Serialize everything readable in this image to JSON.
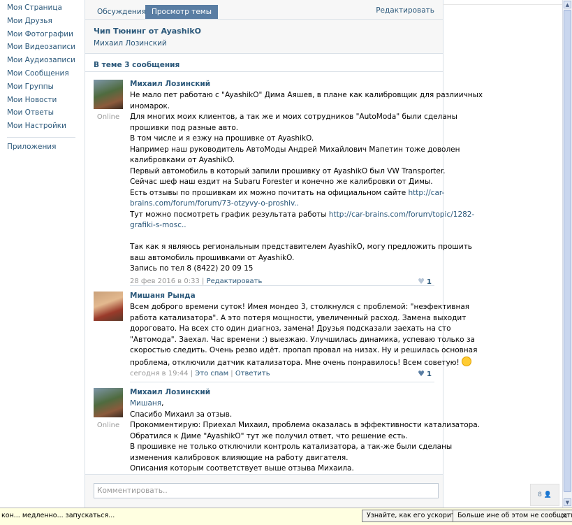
{
  "left_menu": {
    "items": [
      "Моя Страница",
      "Мои Друзья",
      "Мои Фотографии",
      "Мои Видеозаписи",
      "Мои Аудиозаписи",
      "Мои Сообщения",
      "Мои Группы",
      "Мои Новости",
      "Мои Ответы",
      "Мои Настройки"
    ],
    "apps": "Приложения"
  },
  "tabs": {
    "discussions": "Обсуждения",
    "view_topic": "Просмотр темы",
    "edit": "Редактировать"
  },
  "topic": {
    "title": "Чип Тюнинг от AyashikO",
    "author": "Михаил Лозинский",
    "count_text": "В теме 3 сообщения"
  },
  "posts": [
    {
      "author": "Михаил Лозинский",
      "status": "Online",
      "lines": [
        "Не мало пет работаю с \"AyashikO\" Дима Аяшев, в плане как калибровщик для разлиичных",
        "иномарок.",
        "Для многих моих клиентов, а так же и моих сотрудников \"AutoModa\" были сделаны",
        "прошивки под разные авто.",
        "В том числе и я езжу на прошивке от AyashikO.",
        "Например наш руководитель АвтоМоды Андрей Михайлович Мапетин тоже доволен",
        "калибровками от AyashikO.",
        "Первый автомобиль в который запили прошивку от AyashikO был VW Transporter.",
        "Сейчас шеф наш ездит на Subaru Forester и конечно же калибровки от Димы.",
        "Есть отзывы по прошивкам их можно почитать на официальном сайте ",
        "brains.com/forum/forum/73-otzyvy-o-proshiv..",
        "Тут можно посмотреть график результата работы ",
        "grafiki-s-mosc..",
        "",
        "Так как я являюсь региональным представителем AyashikO, могу предложить прошить",
        "ваш автомобиль прошивками от AyashikO.",
        "Запись по тел 8 (8422) 20 09 15"
      ],
      "link1_start": "http://car-",
      "link2_start": "http://car-brains.com/forum/topic/1282-",
      "date": "28 фев 2016 в 0:33",
      "action": "Редактировать",
      "likes": "1"
    },
    {
      "author": "Мишаня Рында",
      "lines": [
        "Всем доброго времени суток! Имея мондео 3, столкнулся с проблемой: \"неэфективная",
        "работа катализатора\". А это потеря мощности, увеличенный расход. Замена выходит",
        "дороговато. На всех сто один диагноз, замена! Друзья подсказали заехать на сто",
        "\"Автомода\". Заехал. Час времени :) выезжаю. Улучшилась динамика, успеваю только за",
        "скоростью следить. Очень резво идёт. пропап провал на низах. Ну и решилась основная",
        "проблема, отключили датчик катализатора. Мне очень понравилось! Всем советую!"
      ],
      "date": "сегодня в 19:44",
      "action1": "Это спам",
      "action2": "Ответить",
      "likes": "1"
    },
    {
      "author": "Михаил Лозинский",
      "status": "Online",
      "reply_to": "Мишаня",
      "lines": [
        "Спасибо Михаил за отзыв.",
        "Прокомментирую: Приехал Михаил, проблема оказалась в эффективности катализатора.",
        "Обратился к Диме \"AyashikO\" тут же получил ответ, что решение есть.",
        "В прошивке не только отключили контроль катализатора, а так-же были сделаны",
        "изменения калибровок влияющие на работу двигателя.",
        "Описания которым соответствует выше отзыва Михаила."
      ]
    }
  ],
  "comment": {
    "placeholder": "Комментировать.."
  },
  "online_widget": "8",
  "notification": {
    "text": "кон... медленно... запускаться...",
    "button_speedup": "Узнайте, как его ускорить",
    "button_dismiss": "Больше ине об этом не сообщать",
    "close": "✕"
  },
  "colors": {
    "link": "#2b587a",
    "tab_selected": "#597da3",
    "panel_bg": "#f7f7f7",
    "border": "#dae1e8",
    "notification_bg": "#ffffe1"
  }
}
